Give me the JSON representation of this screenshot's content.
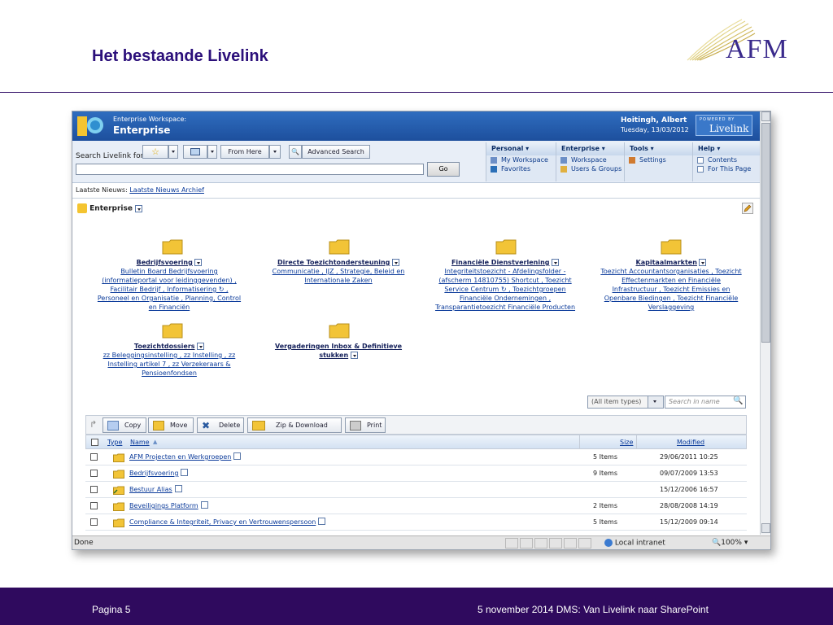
{
  "slide": {
    "title": "Het bestaande Livelink",
    "logo_text": "AFM",
    "footer_page": "Pagina 5",
    "footer_meta": "5 november 2014 DMS: Van Livelink naar SharePoint"
  },
  "app": {
    "workspace_label": "Enterprise Workspace:",
    "workspace_name": "Enterprise",
    "user_name": "Hoitingh, Albert",
    "user_date": "Tuesday, 13/03/2012",
    "powered_label": "POWERED BY",
    "brand": "Livelink"
  },
  "search": {
    "label": "Search Livelink for",
    "from_here": "From Here",
    "advanced": "Advanced Search",
    "go": "Go"
  },
  "menus": [
    {
      "head": "Personal",
      "items": [
        "My Workspace",
        "Favorites"
      ]
    },
    {
      "head": "Enterprise",
      "items": [
        "Workspace",
        "Users & Groups"
      ]
    },
    {
      "head": "Tools",
      "items": [
        "Settings"
      ]
    },
    {
      "head": "Help",
      "items": [
        "Contents",
        "For This Page"
      ]
    }
  ],
  "news": {
    "label": "Laatste Nieuws:",
    "link": "Laatste Nieuws Archief"
  },
  "enterprise_heading": "Enterprise",
  "folders": [
    {
      "title": "Bedrijfsvoering",
      "lines": [
        "Bulletin Board Bedrijfsvoering",
        "(informatieportal voor leidinggevenden) ,",
        "Facilitair Bedrijf , Informatisering ↻ ,",
        "Personeel en Organisatie , Planning, Control",
        "en Financiën"
      ]
    },
    {
      "title": "Directe Toezichtondersteuning",
      "lines": [
        "Communicatie , IJZ , Strategie, Beleid en",
        "Internationale Zaken"
      ]
    },
    {
      "title": "Financiële Dienstverlening",
      "lines": [
        "Integriteitstoezicht - Afdelingsfolder -",
        "(afscherm 14810755) Shortcut , Toezicht",
        "Service Centrum ↻ , Toezichtgroepen",
        "Financiële Ondernemingen ,",
        "Transparantietoezicht Financiële Producten"
      ]
    },
    {
      "title": "Kapitaalmarkten",
      "lines": [
        "Toezicht Accountantsorganisaties , Toezicht",
        "Effectenmarkten en Financiële",
        "Infrastructuur , Toezicht Emissies en",
        "Openbare Biedingen , Toezicht Financiële",
        "Verslaggeving"
      ]
    },
    {
      "title": "Toezichtdossiers",
      "lines": [
        "zz Beleggingsinstelling , zz Instelling , zz",
        "Instelling artikel 7 , zz Verzekeraars &",
        "Pensioenfondsen"
      ]
    },
    {
      "title": "Vergaderingen Inbox & Definitieve",
      "title2": "stukken",
      "lines": []
    }
  ],
  "filter": {
    "item_types": "(All item types)",
    "search_name": "Search in name"
  },
  "actions": [
    "Copy",
    "Move",
    "Delete",
    "Zip & Download",
    "Print"
  ],
  "table": {
    "columns": {
      "type": "Type",
      "name": "Name",
      "size": "Size",
      "modified": "Modified"
    },
    "rows": [
      {
        "name": "AFM Projecten en Werkgroepen",
        "size": "5 Items",
        "modified": "29/06/2011 10:25"
      },
      {
        "name": "Bedrijfsvoering",
        "size": "9 Items",
        "modified": "09/07/2009 13:53"
      },
      {
        "name": "Bestuur Alias",
        "size": "",
        "modified": "15/12/2006 16:57"
      },
      {
        "name": "Beveiligings Platform",
        "size": "2 Items",
        "modified": "28/08/2008 14:19"
      },
      {
        "name": "Compliance & Integriteit, Privacy en Vertrouwenspersoon",
        "size": "5 Items",
        "modified": "15/12/2009 09:14"
      }
    ]
  },
  "statusbar": {
    "status": "Done",
    "zone": "Local intranet",
    "zoom": "100%"
  }
}
